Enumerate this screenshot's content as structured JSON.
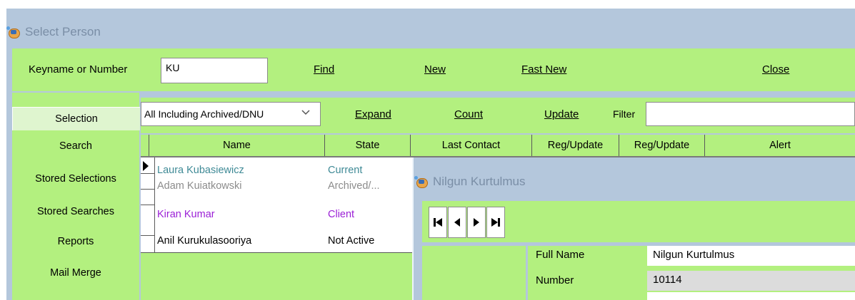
{
  "window": {
    "title": "Select Person"
  },
  "toolbar": {
    "keyname_label": "Keyname or Number",
    "keyname_value": "KU",
    "find_label": "Find",
    "new_label": "New",
    "fast_new_label": "Fast New",
    "close_label": "Close"
  },
  "nav": {
    "items": [
      {
        "label": "Selection"
      },
      {
        "label": "Search"
      },
      {
        "label": "Stored Selections"
      },
      {
        "label": "Stored Searches"
      },
      {
        "label": "Reports"
      },
      {
        "label": "Mail Merge"
      }
    ]
  },
  "selection_bar": {
    "dropdown_value": "All Including Archived/DNU",
    "expand_label": "Expand",
    "count_label": "Count",
    "update_label": "Update",
    "filter_label": "Filter",
    "filter_value": ""
  },
  "grid": {
    "columns": [
      "Name",
      "State",
      "Last Contact",
      "Reg/Update",
      "Reg/Update",
      "Alert"
    ],
    "rows": [
      {
        "name": "Laura Kubasiewicz",
        "state": "Current",
        "color": "#3f8a96"
      },
      {
        "name": "Adam Kuiatkowski",
        "state": "Archived/...",
        "color": "#8c8c8c"
      },
      {
        "name": "Kiran Kumar",
        "state": "Client",
        "color": "#9b1fd6"
      },
      {
        "name": "Anil Kurukulasooriya",
        "state": "Not Active",
        "color": "#000000"
      }
    ]
  },
  "popup": {
    "title": "Nilgun Kurtulmus",
    "nav_buttons": [
      "first-icon",
      "previous-icon",
      "next-icon",
      "last-icon"
    ],
    "fields": [
      {
        "label": "Full Name",
        "value": "Nilgun Kurtulmus"
      },
      {
        "label": "Number",
        "value": "10114"
      }
    ]
  },
  "colors": {
    "panel_green": "#b3f07f",
    "window_blue": "#b4c7dc"
  }
}
